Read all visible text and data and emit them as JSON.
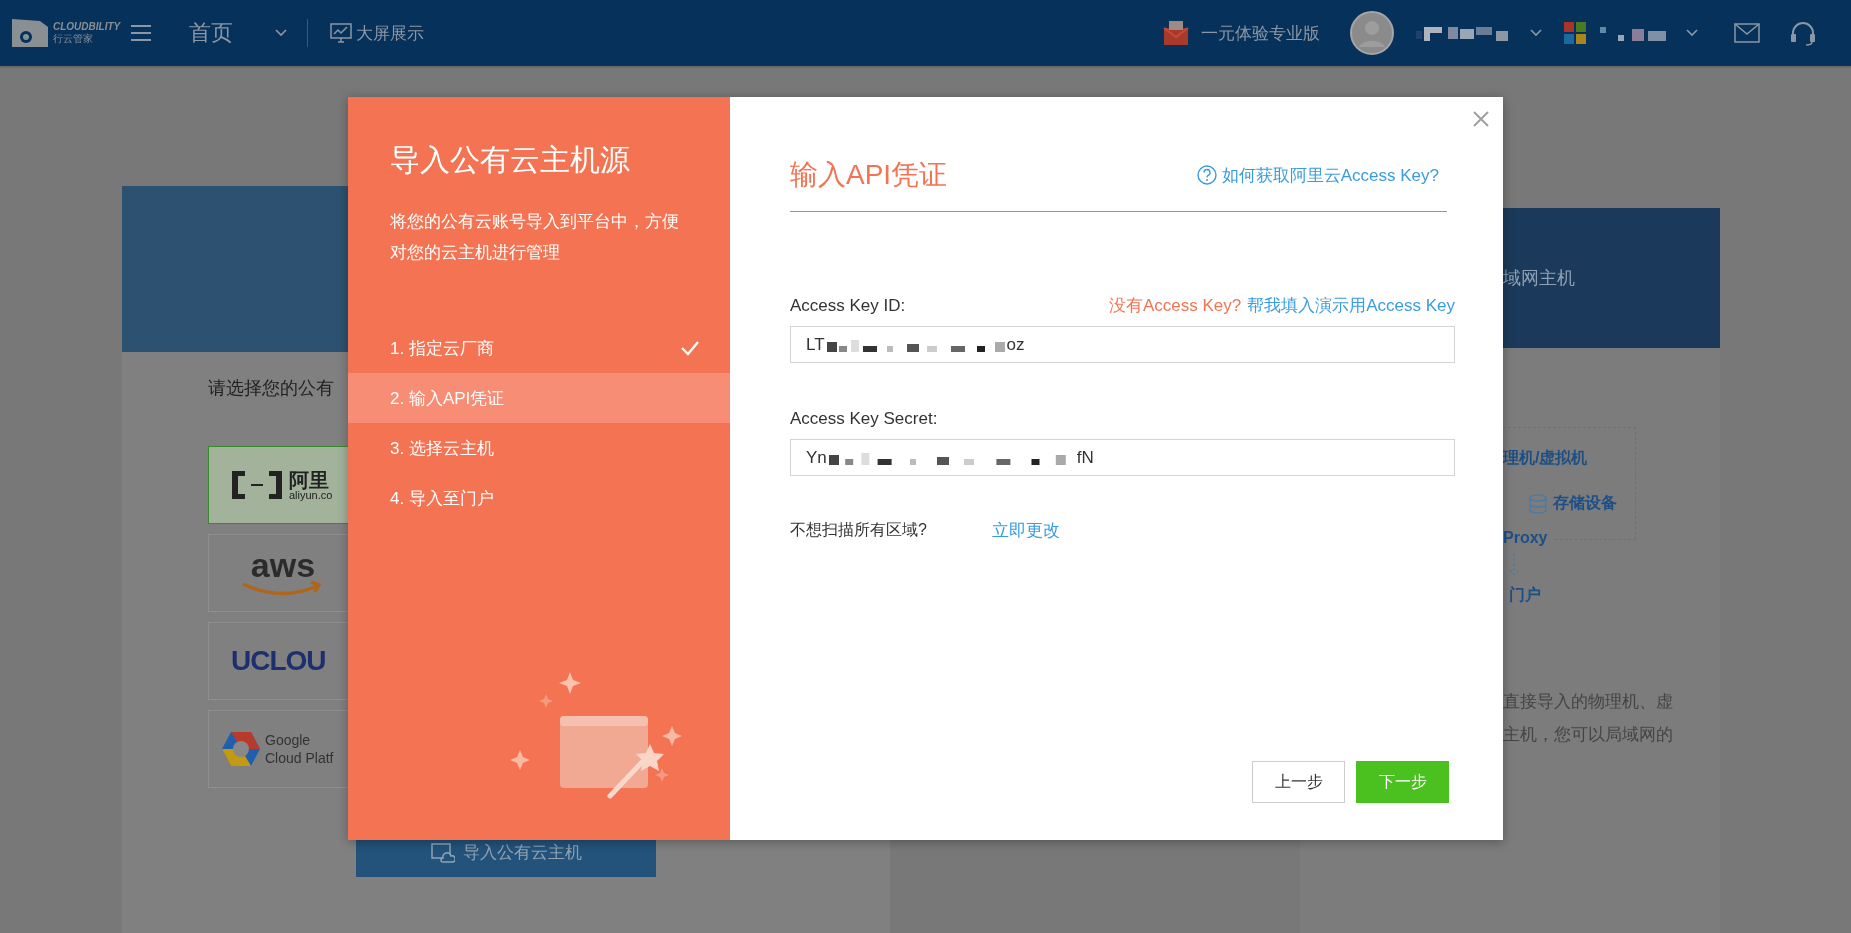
{
  "header": {
    "logo": {
      "wordmark": "CLOUDBILITY",
      "subtitle": "行云管家"
    },
    "nav_title": "首页",
    "screen_link": "大屏展示",
    "promo": "一元体验专业版"
  },
  "background": {
    "left_card": {
      "prompt": "请选择您的公有",
      "providers": [
        {
          "kind": "aliyun",
          "selected": true,
          "texts": [
            "阿里",
            "aliyun.co"
          ]
        },
        {
          "kind": "aws",
          "selected": false,
          "texts": [
            "aws"
          ]
        },
        {
          "kind": "ucloud",
          "selected": false,
          "texts": [
            "UCLOU"
          ]
        },
        {
          "kind": "google",
          "selected": false,
          "texts": [
            "Google",
            "Cloud Platf"
          ]
        }
      ],
      "import_button": "导入公有云主机"
    },
    "right_card": {
      "heading": "域网主机",
      "diagram": {
        "hosts": "理机/虚拟机",
        "storage": "存储设备",
        "proxy": "Proxy",
        "portal": "门户"
      },
      "description_lines": [
        "直接导入的物理机、虚",
        "主机，您可以局域网的"
      ]
    }
  },
  "modal": {
    "title": "导入公有云主机源",
    "description": "将您的公有云账号导入到平台中，方便对您的云主机进行管理",
    "steps": [
      {
        "label": "1. 指定云厂商",
        "selected": false,
        "done": true
      },
      {
        "label": "2. 输入API凭证",
        "selected": true,
        "done": false
      },
      {
        "label": "3. 选择云主机",
        "selected": false,
        "done": false
      },
      {
        "label": "4. 导入至门户",
        "selected": false,
        "done": false
      }
    ],
    "heading": "输入API凭证",
    "help_link": "如何获取阿里云Access Key?",
    "fields": [
      {
        "label": "Access Key ID:",
        "value_prefix": "LT",
        "value_suffix": "oz",
        "hint": "没有Access Key?",
        "action_link": "帮我填入演示用Access Key"
      },
      {
        "label": "Access Key Secret:",
        "value_prefix": "Yn",
        "value_suffix": "fN"
      }
    ],
    "region_prompt": "不想扫描所有区域?",
    "region_link": "立即更改",
    "buttons": [
      {
        "label": "上一步",
        "kind": "secondary"
      },
      {
        "label": "下一步",
        "kind": "primary"
      }
    ]
  }
}
